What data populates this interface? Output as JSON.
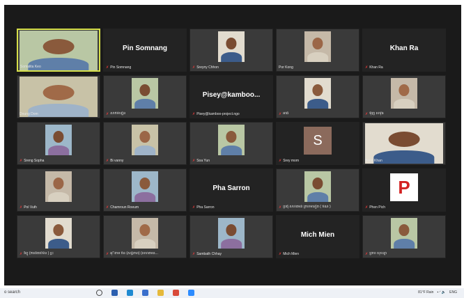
{
  "participants": [
    {
      "name": "Somalita Keo",
      "display": "video",
      "active": true,
      "mic": false
    },
    {
      "name": "Pin Somnang",
      "display": "name",
      "mic": true
    },
    {
      "name": "Sreyny Chhon",
      "display": "video",
      "mic": true
    },
    {
      "name": "Por Kong",
      "display": "video",
      "mic": false
    },
    {
      "name": "Khan Ra",
      "display": "name",
      "mic": true
    },
    {
      "name": "Doung Dom",
      "display": "video",
      "mic": false
    },
    {
      "name": "សាក់ម៉ាទ្បីន",
      "display": "video",
      "mic": true
    },
    {
      "name": "Pisey@kamboo-project.ngo",
      "big": "Pisey@kamboo...",
      "display": "name",
      "mic": true
    },
    {
      "name": "អាធី",
      "display": "video",
      "mic": true
    },
    {
      "name": "ម៉ិញ សាវុធ",
      "display": "video",
      "mic": true
    },
    {
      "name": "Sreng Sopha",
      "display": "video",
      "mic": true
    },
    {
      "name": "Bi vanny",
      "display": "video",
      "mic": true
    },
    {
      "name": "Soa Yun",
      "display": "video",
      "mic": true
    },
    {
      "name": "Srey mom",
      "display": "letter",
      "letter": "S",
      "mic": true
    },
    {
      "name": "Borin Khan",
      "display": "video",
      "mic": false
    },
    {
      "name": "Pol Vuth",
      "display": "video",
      "mic": true
    },
    {
      "name": "Chamroun Roeum",
      "display": "video",
      "mic": true
    },
    {
      "name": "Pha Sarron",
      "display": "name",
      "mic": true
    },
    {
      "name": "ប្រជុំ សហគមន៍ ក្រហមទៀត ( ចំណ )",
      "display": "video",
      "mic": true
    },
    {
      "name": "Phen Pich",
      "display": "letter",
      "letter": "P",
      "mic": true
    },
    {
      "name": "វិទ្យុ (ការពិតបើទិន ) ខ្លះ",
      "display": "video",
      "mic": true
    },
    {
      "name": "អុ៊ីតាម ចឹន (សន្ធិភាព) (សហគមន...",
      "display": "video",
      "mic": true
    },
    {
      "name": "Sambath Chhay",
      "display": "video",
      "mic": true
    },
    {
      "name": "Mich Mien",
      "display": "name",
      "mic": true
    },
    {
      "name": "ព្រាប សុខន្យា",
      "display": "video",
      "mic": true
    }
  ],
  "taskbar": {
    "search_text": "o search",
    "weather": "81°F Rain",
    "lang": "ENG",
    "icons": [
      "task-view-icon",
      "widgets-icon",
      "edge-icon",
      "store-icon",
      "explorer-icon",
      "chrome-icon",
      "zoom-icon"
    ]
  }
}
